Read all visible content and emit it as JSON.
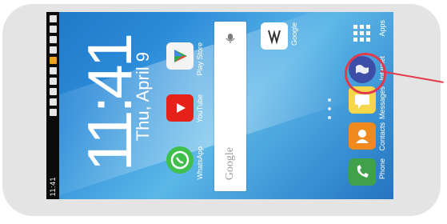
{
  "status_bar": {
    "time": "11:41"
  },
  "clock_widget": {
    "time": "11:41",
    "date": "Thu, April 9"
  },
  "search_bar": {
    "brand": "Google"
  },
  "apps": [
    {
      "label": "Phone",
      "color": "#3fa24a",
      "icon": "phone-icon"
    },
    {
      "label": "Contacts",
      "color": "#f08a1e",
      "icon": "contacts-icon"
    },
    {
      "label": "Messages",
      "color": "#f6d64a",
      "icon": "messages-icon"
    },
    {
      "label": "Internet",
      "color": "#3c4ea8",
      "icon": "globe-icon"
    },
    {
      "label": "Apps",
      "color": "#ffffff",
      "icon": "apps-grid-icon"
    },
    {
      "label": "WhatsApp",
      "color": "#3fbf4c",
      "icon": "whatsapp-icon"
    },
    {
      "label": "YouTube",
      "color": "#e62117",
      "icon": "youtube-icon"
    },
    {
      "label": "Play Store",
      "color": "#f4f4f4",
      "icon": "play-store-icon"
    },
    {
      "label": "Google",
      "color": "#ffffff",
      "icon": "google-icon"
    }
  ],
  "colors": {
    "highlight": "#e33a4a"
  }
}
